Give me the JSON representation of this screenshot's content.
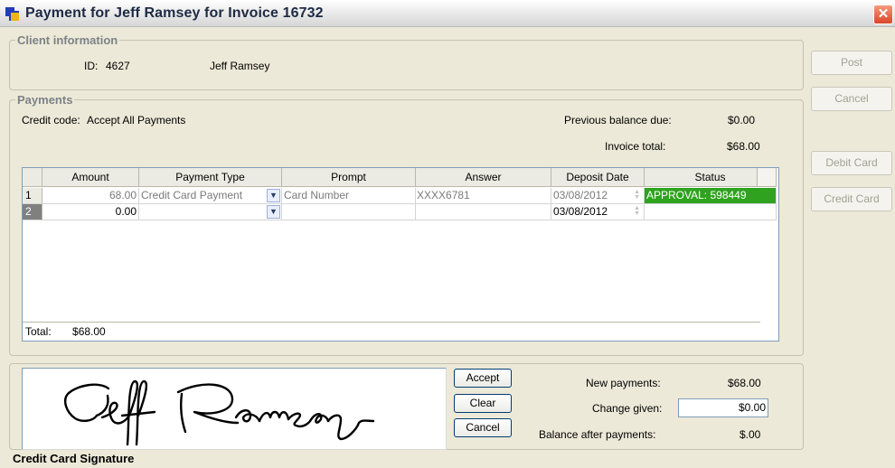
{
  "window": {
    "title": "Payment for Jeff Ramsey for Invoice 16732",
    "close_glyph": "✕",
    "icon": "app-icon"
  },
  "client": {
    "legend": "Client information",
    "id_label": "ID:",
    "id_value": "4627",
    "name": "Jeff Ramsey"
  },
  "payments": {
    "legend": "Payments",
    "credit_code_label": "Credit code:",
    "credit_code_value": "Accept All Payments",
    "previous_balance_label": "Previous balance due:",
    "previous_balance_value": "$0.00",
    "invoice_total_label": "Invoice total:",
    "invoice_total_value": "$68.00",
    "columns": [
      "Amount",
      "Payment Type",
      "Prompt",
      "Answer",
      "Deposit Date",
      "Status"
    ],
    "rows": [
      {
        "num": "1",
        "amount": "68.00",
        "payment_type": "Credit Card Payment",
        "prompt": "Card Number",
        "answer": "XXXX6781",
        "deposit_date": "03/08/2012",
        "status": "APPROVAL: 598449"
      },
      {
        "num": "2",
        "amount": "0.00",
        "payment_type": "",
        "prompt": "",
        "answer": "",
        "deposit_date": "03/08/2012",
        "status": ""
      }
    ],
    "total_label": "Total:",
    "total_value": "$68.00"
  },
  "side_buttons": {
    "post": "Post",
    "cancel": "Cancel",
    "debit_card": "Debit Card",
    "credit_card": "Credit Card"
  },
  "signature": {
    "label": "Credit Card Signature",
    "accept": "Accept",
    "clear": "Clear",
    "cancel": "Cancel"
  },
  "summary": {
    "new_payments_label": "New payments:",
    "new_payments_value": "$68.00",
    "change_given_label": "Change given:",
    "change_given_value": "$0.00",
    "balance_after_label": "Balance after payments:",
    "balance_after_value": "$.00"
  },
  "colors": {
    "approval_green": "#2fa21f",
    "window_bg": "#ece9d8"
  }
}
